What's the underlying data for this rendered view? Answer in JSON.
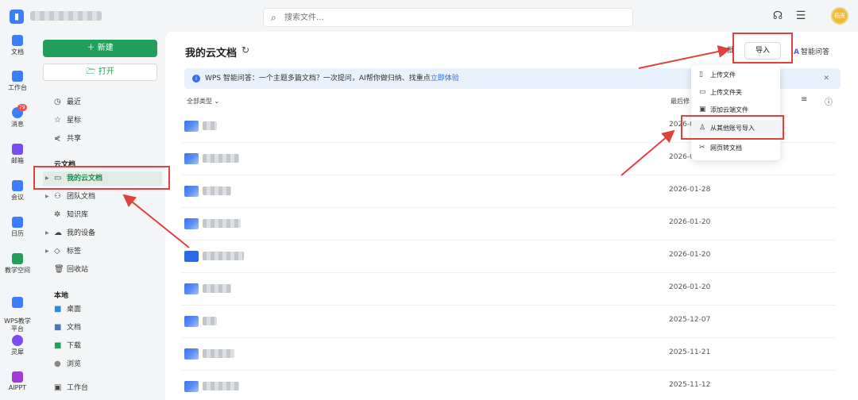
{
  "topbar": {
    "search_placeholder": "搜索文件...",
    "avatar_text": "稻壳"
  },
  "rail": [
    {
      "label": "文档",
      "color": "#3d7eff"
    },
    {
      "label": "工作台",
      "color": "#3d7eff"
    },
    {
      "label": "消息",
      "color": "#3d7eff",
      "badge": "79"
    },
    {
      "label": "邮箱",
      "color": "#7a4df0"
    },
    {
      "label": "会议",
      "color": "#3d7eff"
    },
    {
      "label": "日历",
      "color": "#3d7eff"
    },
    {
      "label": "教学空间",
      "color": "#22a05b"
    },
    {
      "label": "WPS教学\n平台",
      "color": "#3d7eff"
    },
    {
      "label": "灵犀",
      "color": "#7a4df0"
    },
    {
      "label": "AIPPT",
      "color": "#a03cd6"
    }
  ],
  "side": {
    "new_label": "新建",
    "open_label": "打开",
    "recent": "最近",
    "starred": "星标",
    "shared": "共享",
    "cloud_section": "云文档",
    "my_cloud": "我的云文档",
    "team_docs": "团队文档",
    "knowledge": "知识库",
    "my_devices": "我的设备",
    "tags": "标签",
    "recycle": "回收站",
    "local_section": "本地",
    "desktop": "桌面",
    "documents": "文档",
    "downloads": "下载",
    "browse": "浏览",
    "workbench": "工作台"
  },
  "main": {
    "title": "我的云文档",
    "batch_partial": "批",
    "import_label": "导入",
    "ai_label": "智能问答",
    "banner_text": "WPS 智能问答：一个主题多篇文档？一次提问，AI帮你做归纳、找重点",
    "banner_link": "立即体验",
    "filter_label": "全部类型",
    "col_modified": "最后修"
  },
  "files": [
    {
      "date": "2026-0",
      "folder": false
    },
    {
      "date": "2026-0",
      "folder": false
    },
    {
      "date": "2026-01-28",
      "folder": false
    },
    {
      "date": "2026-01-20",
      "folder": false
    },
    {
      "date": "2026-01-20",
      "folder": true
    },
    {
      "date": "2026-01-20",
      "folder": false
    },
    {
      "date": "2025-12-07",
      "folder": false
    },
    {
      "date": "2025-11-21",
      "folder": false
    },
    {
      "date": "2025-11-12",
      "folder": false
    }
  ],
  "menu": {
    "upload_file": "上传文件",
    "upload_folder": "上传文件夹",
    "add_cloud": "添加云端文件",
    "import_other": "从其他账号导入",
    "web_to_doc": "网页转文档"
  },
  "colors": {
    "accent": "#22a05b",
    "annotation": "#e0413f",
    "link": "#2f6ce5"
  }
}
